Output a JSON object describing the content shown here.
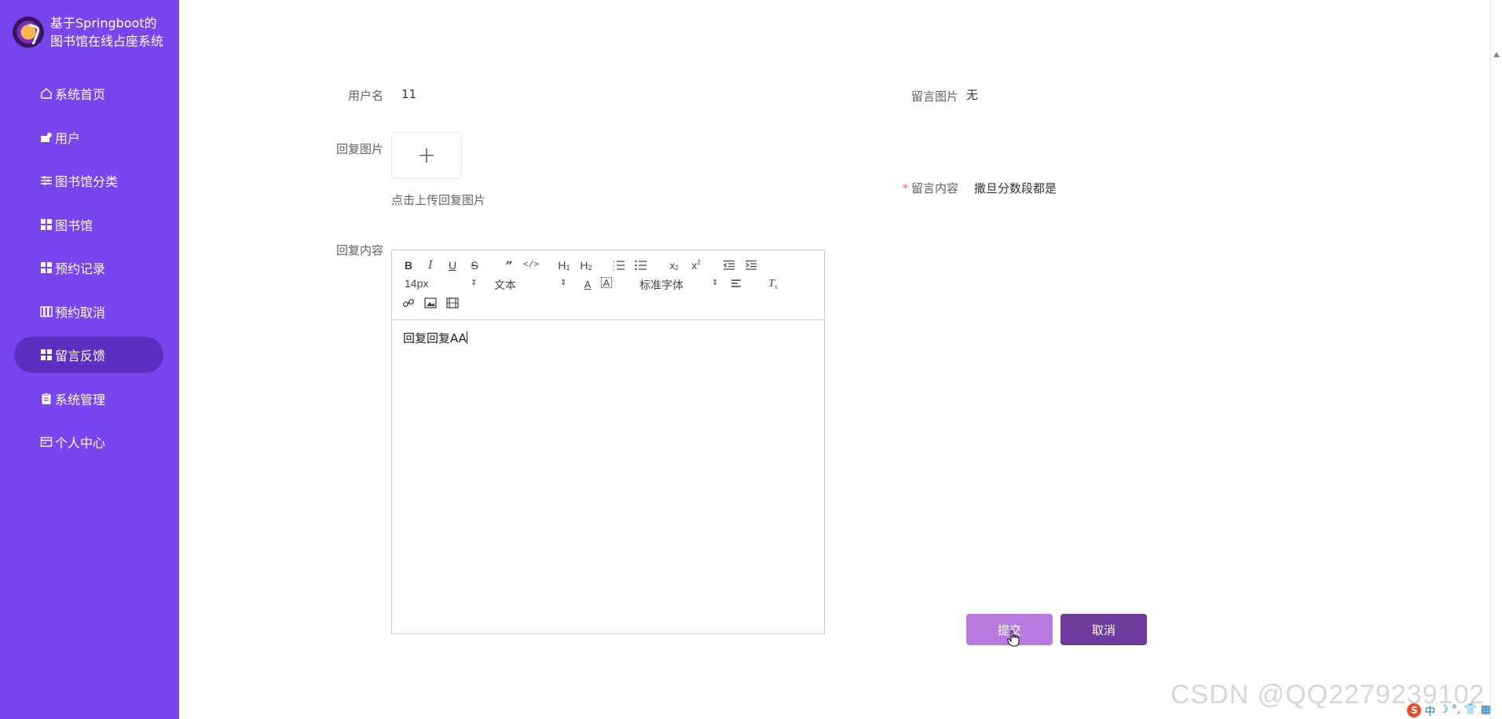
{
  "sidebar": {
    "title": "基于Springboot的图书馆在线占座系统",
    "items": [
      {
        "label": "系统首页",
        "icon": "home-icon"
      },
      {
        "label": "用户",
        "icon": "user-icon"
      },
      {
        "label": "图书馆分类",
        "icon": "sliders-icon"
      },
      {
        "label": "图书馆",
        "icon": "grid-icon"
      },
      {
        "label": "预约记录",
        "icon": "grid-icon"
      },
      {
        "label": "预约取消",
        "icon": "chart-icon"
      },
      {
        "label": "留言反馈",
        "icon": "grid-icon",
        "active": true
      },
      {
        "label": "系统管理",
        "icon": "clipboard-icon"
      },
      {
        "label": "个人中心",
        "icon": "card-icon"
      }
    ]
  },
  "form": {
    "username_label": "用户名",
    "username_value": "11",
    "message_image_label": "留言图片",
    "message_image_value": "无",
    "reply_image_label": "回复图片",
    "upload_hint": "点击上传回复图片",
    "message_content_label": "留言内容",
    "message_content_value": "撒旦分数段都是",
    "reply_content_label": "回复内容"
  },
  "editor": {
    "font_size": "14px",
    "header_select": "文本",
    "font_family": "标准字体",
    "content": "回复回复AA"
  },
  "buttons": {
    "submit": "提交",
    "cancel": "取消"
  },
  "watermark": "CSDN @QQ2279239102",
  "tray": {
    "ime_mode": "中"
  },
  "colors": {
    "sidebar_bg": "#7a44ee",
    "active_item": "#5b2fbf",
    "submit_bg": "#b97ae0",
    "cancel_bg": "#6f3c9e"
  }
}
